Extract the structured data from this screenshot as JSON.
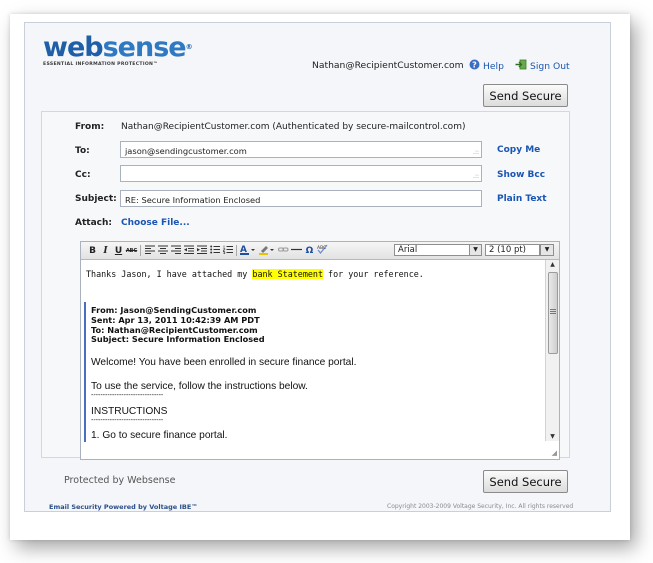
{
  "header": {
    "logo": {
      "word_a": "web",
      "word_b": "sense",
      "reg": "®",
      "tagline": "ESSENTIAL INFORMATION PROTECTION™"
    },
    "user_email": "Nathan@RecipientCustomer.com",
    "help_label": "Help",
    "sign_out_label": "Sign Out",
    "help_icon": "help-icon",
    "sign_out_icon": "sign-out-icon"
  },
  "actions": {
    "send_secure_label": "Send Secure"
  },
  "form": {
    "from_label": "From:",
    "from_value": "Nathan@RecipientCustomer.com (Authenticated by secure-mailcontrol.com)",
    "to_label": "To:",
    "to_value": "jason@sendingcustomer.com",
    "copy_me_label": "Copy Me",
    "cc_label": "Cc:",
    "cc_value": "",
    "show_bcc_label": "Show Bcc",
    "subject_label": "Subject:",
    "subject_value": "RE: Secure Information Enclosed",
    "plain_text_label": "Plain Text",
    "attach_label": "Attach:",
    "choose_file_label": "Choose File..."
  },
  "editor": {
    "toolbar": {
      "bold": "B",
      "italic": "I",
      "underline": "U",
      "strike": "ABC",
      "font_family": "Arial",
      "font_size": "2 (10 pt)"
    },
    "body": {
      "line1_pre": "Thanks Jason, I have attached my ",
      "line1_highlight": "bank Statement",
      "line1_post": " for your reference.",
      "quote_from": "From: Jason@SendingCustomer.com",
      "quote_sent": "Sent: Apr 13, 2011 10:42:39 AM PDT",
      "quote_to": "To: Nathan@RecipientCustomer.com",
      "quote_subject": "Subject: Secure Information Enclosed",
      "welcome": "Welcome! You have been enrolled in secure finance portal.",
      "instructions_intro": "To use the service, follow the instructions below.",
      "rule": "-------------------------------",
      "instructions_heading": "INSTRUCTIONS",
      "step1": "1. Go to secure finance portal."
    }
  },
  "footer": {
    "protected_by": "Protected by Websense",
    "powered_by": "Email Security Powered by Voltage IBE™",
    "copyright": "Copyright 2003-2009 Voltage Security, Inc. All rights reserved"
  },
  "colors": {
    "link": "#1a56b3",
    "highlight": "#ffff00",
    "brand": "#1f5fa8"
  }
}
